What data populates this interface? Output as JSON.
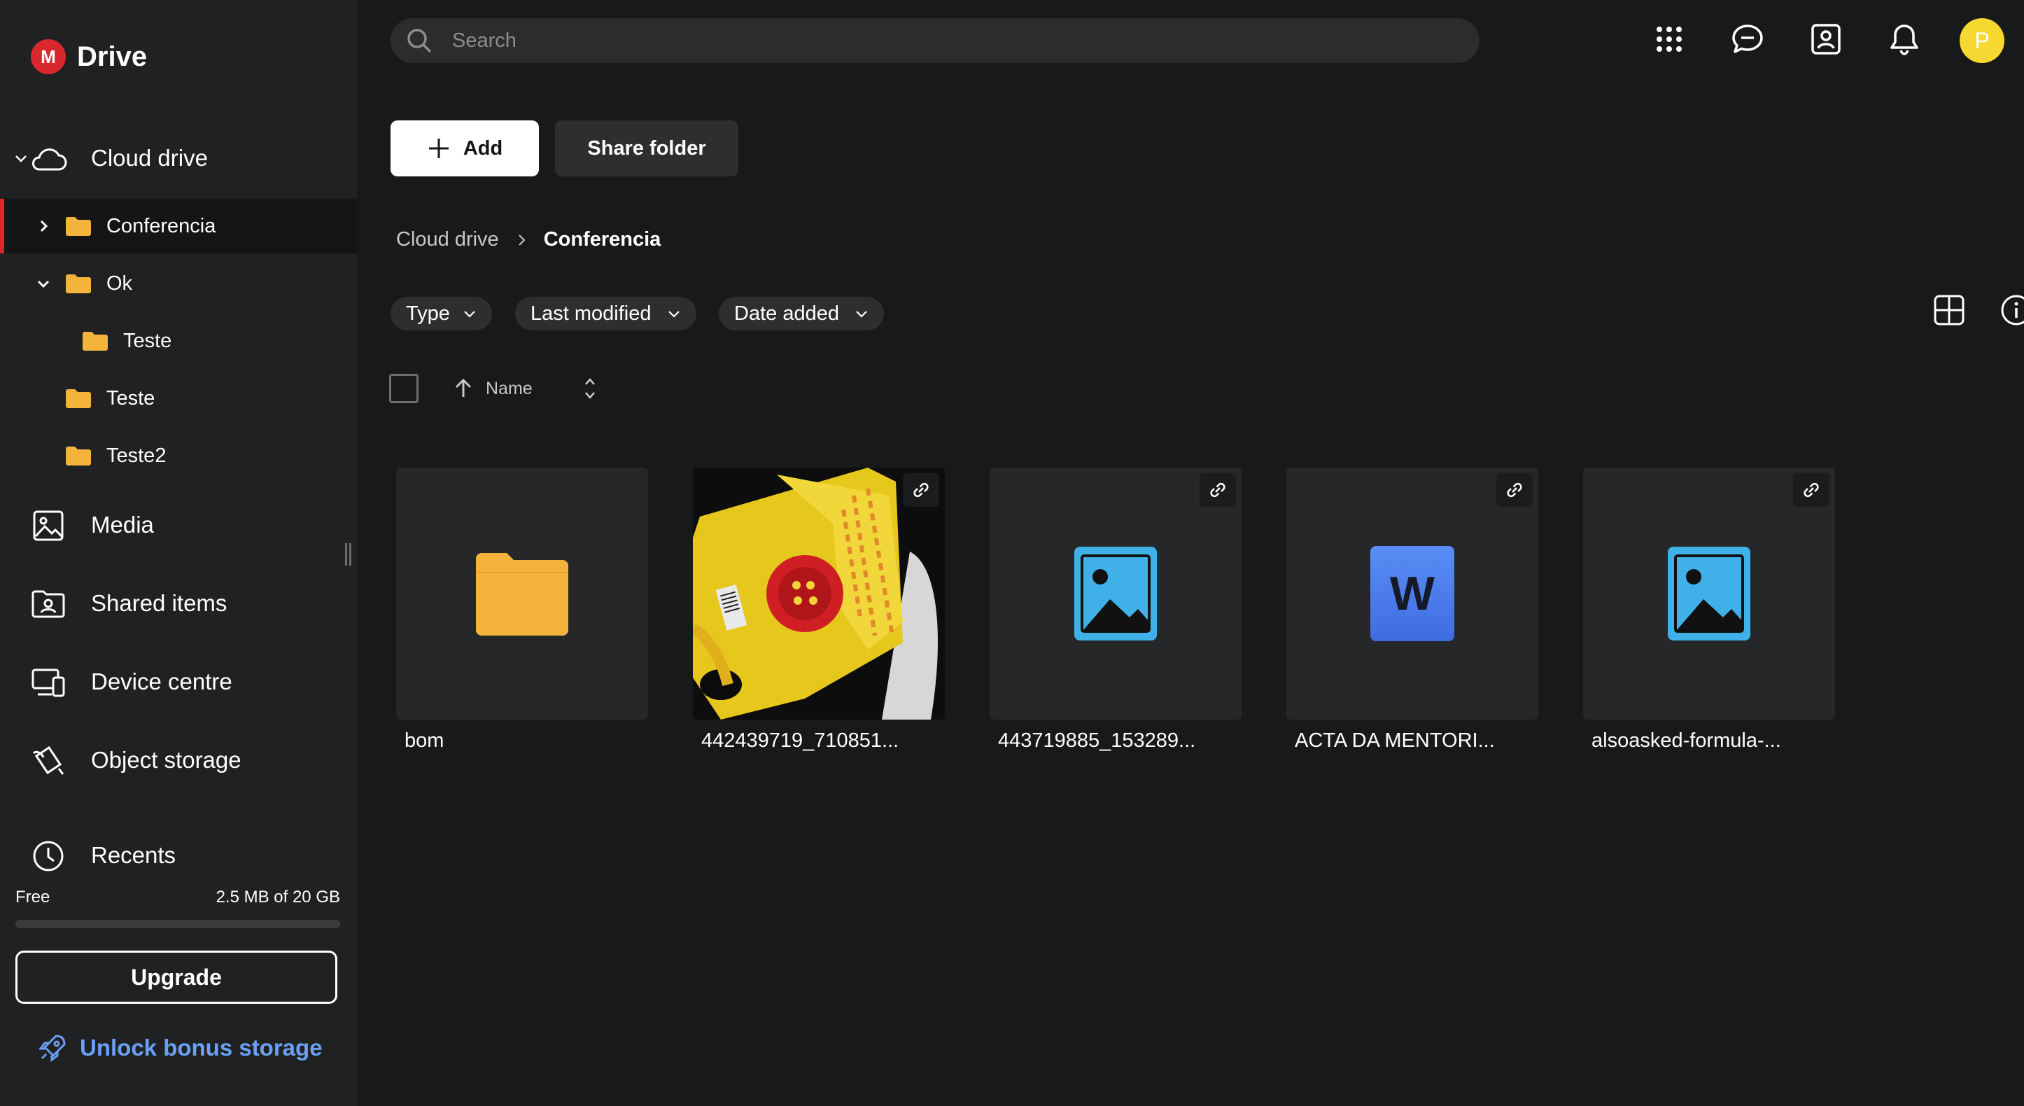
{
  "app": {
    "logo_letter": "M",
    "title": "Drive"
  },
  "sidebar": {
    "cloud_drive": "Cloud drive",
    "tree": [
      {
        "label": "Conferencia",
        "expanded": false,
        "selected": true
      },
      {
        "label": "Ok",
        "expanded": true,
        "selected": false
      },
      {
        "label": "Teste",
        "child_of": "Ok"
      },
      {
        "label": "Teste"
      },
      {
        "label": "Teste2"
      }
    ],
    "items": [
      {
        "label": "Media",
        "icon": "image-icon"
      },
      {
        "label": "Shared items",
        "icon": "shared-folder-icon"
      },
      {
        "label": "Device centre",
        "icon": "devices-icon"
      },
      {
        "label": "Object storage",
        "icon": "bucket-icon"
      },
      {
        "label": "Recents",
        "icon": "clock-icon"
      }
    ],
    "storage": {
      "plan": "Free",
      "usage": "2.5 MB of 20 GB",
      "used_fraction": 0.000125
    },
    "upgrade_label": "Upgrade",
    "bonus_label": "Unlock bonus storage"
  },
  "header": {
    "search_placeholder": "Search",
    "avatar_initial": "P",
    "icons": [
      "apps-grid-icon",
      "chat-icon",
      "contacts-icon",
      "bell-icon"
    ]
  },
  "toolbar": {
    "add_label": "Add",
    "share_label": "Share folder"
  },
  "breadcrumb": {
    "root": "Cloud drive",
    "current": "Conferencia"
  },
  "filters": [
    "Type",
    "Last modified",
    "Date added"
  ],
  "sort": {
    "label": "Name"
  },
  "files": [
    {
      "name": "bom",
      "kind": "folder",
      "linked": false
    },
    {
      "name": "442439719_710851...",
      "kind": "photo",
      "linked": true
    },
    {
      "name": "443719885_153289...",
      "kind": "image",
      "linked": true
    },
    {
      "name": "ACTA DA MENTORI...",
      "kind": "word",
      "linked": true
    },
    {
      "name": "alsoasked-formula-...",
      "kind": "image",
      "linked": true
    }
  ],
  "word_letter": "W",
  "colors": {
    "accent": "#d9272e",
    "folder": "#f4b33a",
    "link": "#6aa1f5",
    "avatar": "#f5d830"
  }
}
